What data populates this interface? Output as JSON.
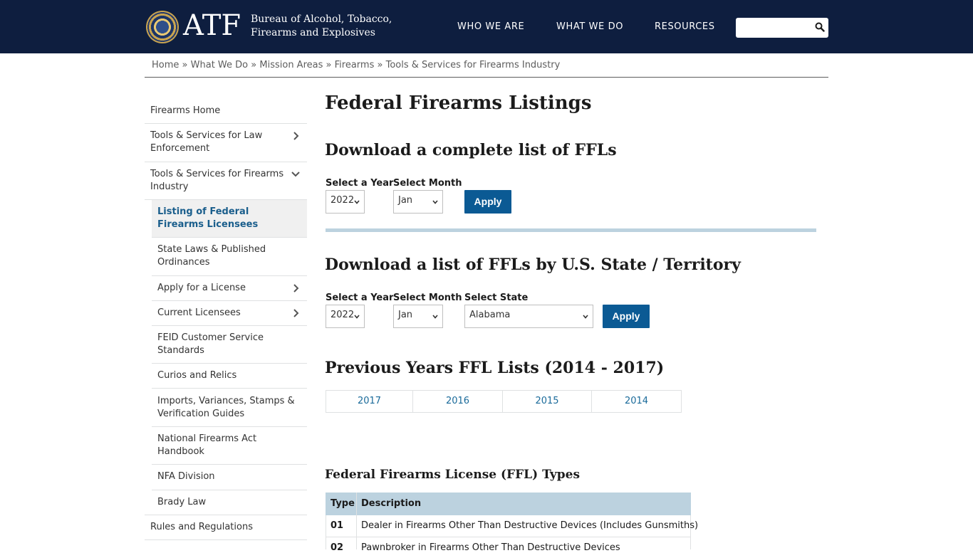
{
  "header": {
    "logo": "ATF",
    "agency_line1": "Bureau of Alcohol, Tobacco,",
    "agency_line2": "Firearms and Explosives",
    "nav": [
      "WHO WE ARE",
      "WHAT WE DO",
      "RESOURCES"
    ],
    "search_value": ""
  },
  "breadcrumb": [
    "Home",
    "What We Do",
    "Mission Areas",
    "Firearms",
    "Tools & Services for Firearms Industry"
  ],
  "breadcrumb_sep": "»",
  "sidebar": {
    "items": [
      {
        "label": "Firearms Home"
      },
      {
        "label": "Tools & Services for Law Enforcement"
      },
      {
        "label": "Tools & Services for Firearms Industry"
      },
      {
        "label": "Listing of Federal Firearms Licensees"
      },
      {
        "label": "State Laws & Published Ordinances"
      },
      {
        "label": "Apply for a License"
      },
      {
        "label": "Current Licensees"
      },
      {
        "label": "FEID Customer Service Standards"
      },
      {
        "label": "Curios and Relics"
      },
      {
        "label": "Imports, Variances, Stamps & Verification Guides"
      },
      {
        "label": "National Firearms Act Handbook"
      },
      {
        "label": "NFA Division"
      },
      {
        "label": "Brady Law"
      },
      {
        "label": "Rules and Regulations"
      }
    ]
  },
  "main": {
    "title": "Federal Firearms Listings",
    "complete": {
      "heading": "Download a complete list of FFLs",
      "year_label": "Select a Year",
      "year_value": "2022",
      "month_label": "Select Month",
      "month_value": "Jan",
      "apply": "Apply"
    },
    "by_state": {
      "heading": "Download a list of FFLs by U.S. State / Territory",
      "year_label": "Select a Year",
      "year_value": "2022",
      "month_label": "Select Month",
      "month_value": "Jan",
      "state_label": "Select State",
      "state_value": "Alabama",
      "apply": "Apply"
    },
    "previous": {
      "heading": "Previous Years FFL Lists (2014 - 2017)",
      "years": [
        "2017",
        "2016",
        "2015",
        "2014"
      ]
    },
    "types": {
      "heading": "Federal Firearms License (FFL) Types",
      "col_type": "Type",
      "col_desc": "Description",
      "rows": [
        {
          "type": "01",
          "desc": "Dealer in Firearms Other Than Destructive Devices (Includes Gunsmiths)"
        },
        {
          "type": "02",
          "desc": "Pawnbroker in Firearms Other Than Destructive Devices"
        }
      ]
    }
  }
}
